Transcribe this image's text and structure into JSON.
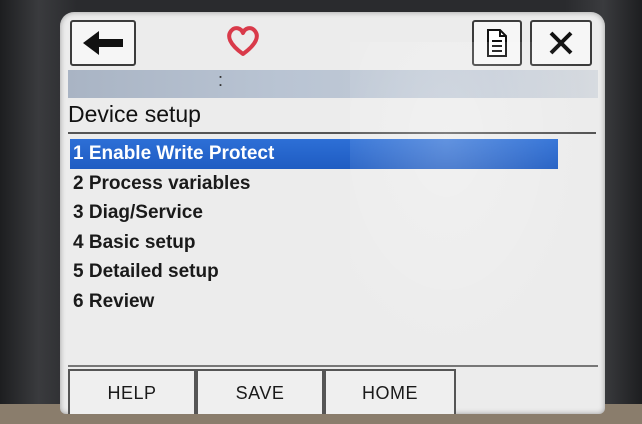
{
  "toolbar": {
    "back_icon": "left-arrow-icon",
    "status_icon": "heart-icon",
    "status_icon_color": "#d93a4a",
    "doc_icon": "document-icon",
    "close_icon": "close-icon"
  },
  "status_strip": {
    "text": ":"
  },
  "screen": {
    "title": "Device setup"
  },
  "menu": {
    "items": [
      {
        "label": "1 Enable Write Protect",
        "selected": true
      },
      {
        "label": "2 Process variables",
        "selected": false
      },
      {
        "label": "3 Diag/Service",
        "selected": false
      },
      {
        "label": "4 Basic setup",
        "selected": false
      },
      {
        "label": "5 Detailed setup",
        "selected": false
      },
      {
        "label": "6 Review",
        "selected": false
      }
    ]
  },
  "softkeys": {
    "help": "HELP",
    "save": "SAVE",
    "home": "HOME"
  },
  "colors": {
    "selection": "#2466cc",
    "strip": "#b9c4d3"
  }
}
